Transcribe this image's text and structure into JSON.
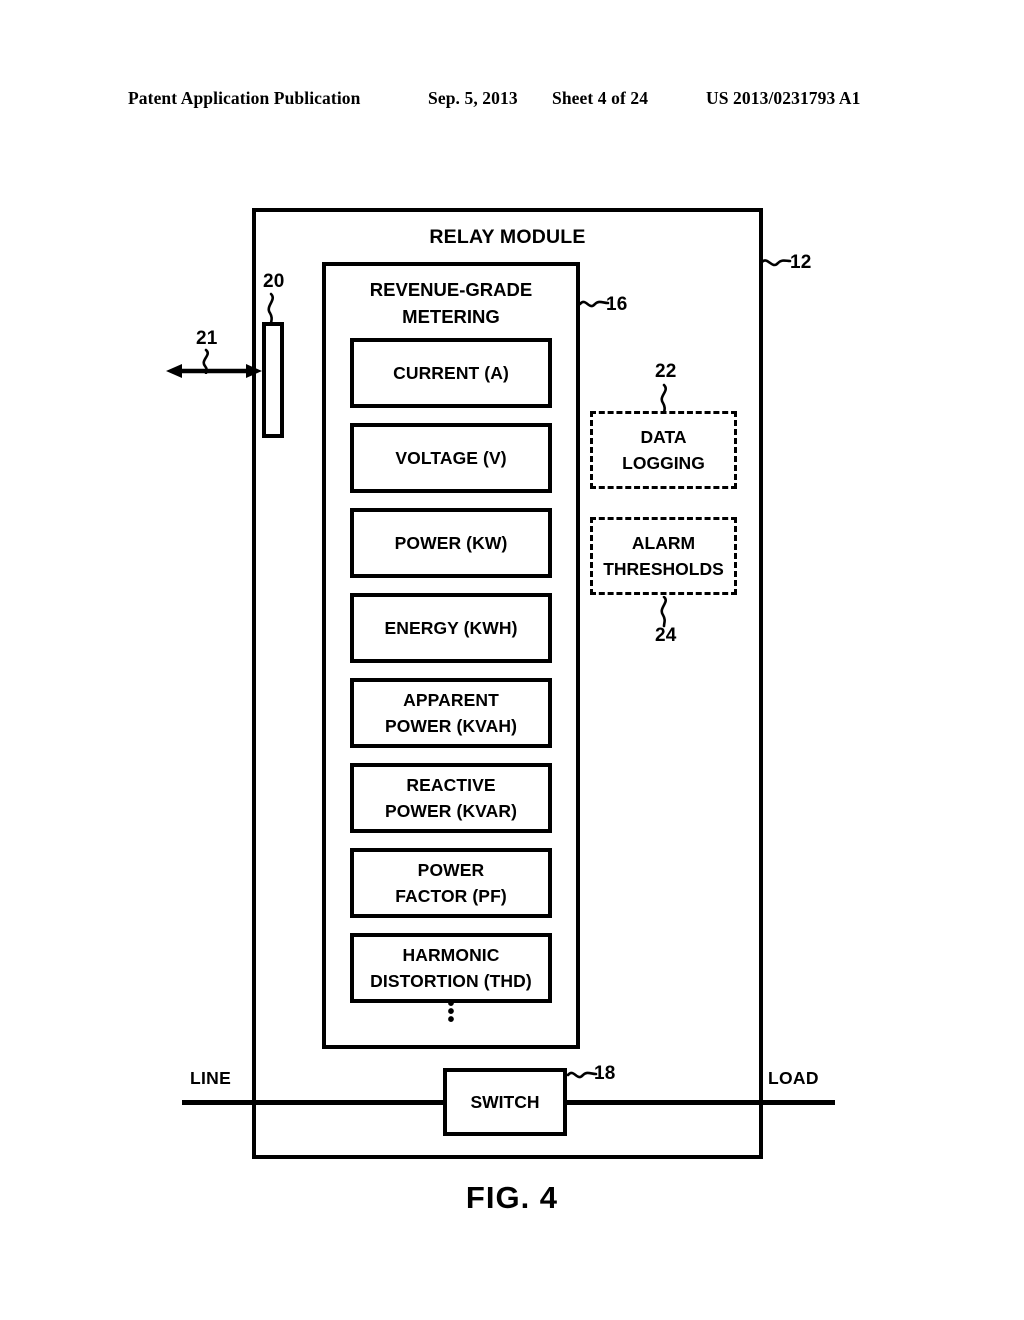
{
  "header": {
    "title": "Patent Application Publication",
    "date": "Sep. 5, 2013",
    "sheet": "Sheet 4 of 24",
    "patent_number": "US 2013/0231793 A1"
  },
  "figure": {
    "caption": "FIG. 4",
    "relay_module": {
      "title": "RELAY MODULE",
      "ref": "12"
    },
    "port": {
      "ref": "20"
    },
    "communication_arrow": {
      "ref": "21"
    },
    "metering": {
      "title_line1": "REVENUE-GRADE",
      "title_line2": "METERING",
      "ref": "16",
      "ellipsis": "•",
      "items": [
        {
          "label": "CURRENT (A)"
        },
        {
          "label": "VOLTAGE (V)"
        },
        {
          "label": "POWER (KW)"
        },
        {
          "label": "ENERGY (KWH)"
        },
        {
          "label": "APPARENT\nPOWER (KVAH)"
        },
        {
          "label": "REACTIVE\nPOWER (KVAR)"
        },
        {
          "label": "POWER\nFACTOR (PF)"
        },
        {
          "label": "HARMONIC\nDISTORTION (THD)"
        }
      ]
    },
    "options": [
      {
        "label": "DATA\nLOGGING",
        "ref": "22"
      },
      {
        "label": "ALARM\nTHRESHOLDS",
        "ref": "24"
      }
    ],
    "switch": {
      "label": "SWITCH",
      "ref": "18"
    },
    "rails": {
      "line": "LINE",
      "load": "LOAD"
    }
  },
  "colors": {
    "ink": "#000000",
    "paper": "#ffffff"
  }
}
